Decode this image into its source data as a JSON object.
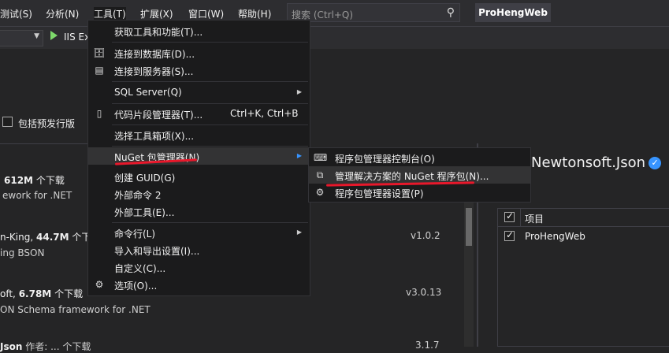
{
  "menubar": {
    "items": [
      "测试(S)",
      "分析(N)",
      "工具(T)",
      "扩展(X)",
      "窗口(W)",
      "帮助(H)"
    ],
    "search_placeholder": "搜索 (Ctrl+Q)",
    "project_name": "ProHengWeb"
  },
  "toolbar": {
    "run_label": "IIS Ex"
  },
  "left_panel": {
    "prerelease_label": "包括预发行版",
    "packages": [
      {
        "line1_a": "612M",
        "line1_b": " 个下载",
        "line2": "ework for .NET",
        "version": ""
      },
      {
        "line1_a": "n-King, ",
        "line1_bold": "44.7M",
        "line1_b": " 个下",
        "line2": "ing BSON",
        "version": "v1.0.2"
      },
      {
        "line1_a": "oft, ",
        "line1_bold": "6.78M",
        "line1_b": " 个下载",
        "line2": "ON Schema framework for .NET",
        "version": "v3.0.13"
      },
      {
        "line1_a": "Json",
        "line1_b": " 作者: ... 个下载",
        "line2": "",
        "version": "3.1.7"
      }
    ]
  },
  "tools_menu": {
    "items": [
      {
        "label": "获取工具和功能(T)...",
        "icon": ""
      },
      {
        "label": "连接到数据库(D)...",
        "icon": "database-plus-icon"
      },
      {
        "label": "连接到服务器(S)...",
        "icon": "server-plus-icon"
      },
      {
        "label": "SQL Server(Q)",
        "submenu": true
      },
      {
        "label": "代码片段管理器(T)...",
        "shortcut": "Ctrl+K, Ctrl+B",
        "icon": "snippet-icon"
      },
      {
        "label": "选择工具箱项(X)..."
      },
      {
        "label": "NuGet 包管理器(N)",
        "submenu": true
      },
      {
        "label": "创建 GUID(G)"
      },
      {
        "label": "外部命令 2"
      },
      {
        "label": "外部工具(E)..."
      },
      {
        "label": "命令行(L)",
        "submenu": true
      },
      {
        "label": "导入和导出设置(I)..."
      },
      {
        "label": "自定义(C)..."
      },
      {
        "label": "选项(O)...",
        "icon": "gear-icon"
      }
    ]
  },
  "nuget_submenu": {
    "items": [
      {
        "label": "程序包管理器控制台(O)",
        "icon": "console-icon"
      },
      {
        "label": "管理解决方案的 NuGet 程序包(N)...",
        "icon": "package-icon"
      },
      {
        "label": "程序包管理器设置(P)",
        "icon": "gear-icon"
      }
    ]
  },
  "right_panel": {
    "package_title": "Newtonsoft.Json",
    "table_header": "项目",
    "projects": [
      "ProHengWeb"
    ]
  },
  "colors": {
    "accent_red": "#e8182b",
    "verify_blue": "#3794ff",
    "menu_bg": "#1b1b1c",
    "highlight": "#333334"
  }
}
